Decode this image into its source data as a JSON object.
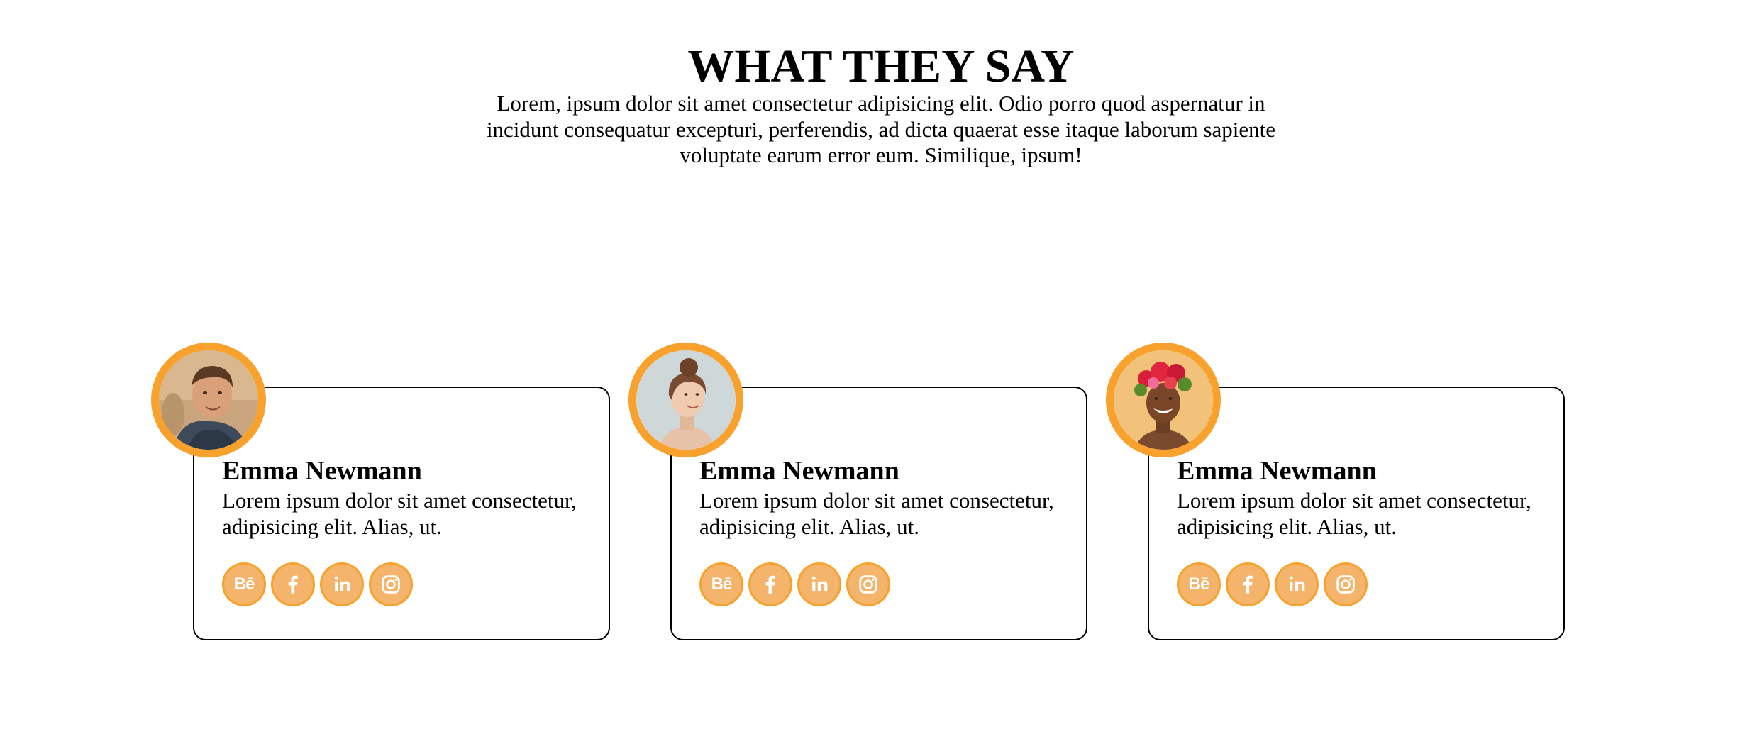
{
  "header": {
    "title": "WHAT THEY SAY",
    "intro": "Lorem, ipsum dolor sit amet consectetur adipisicing elit. Odio porro quod aspernatur in incidunt consequatur excepturi, perferendis, ad dicta quaerat esse itaque laborum sapiente voluptate earum error eum. Similique, ipsum!"
  },
  "colors": {
    "accent": "#f8a12c",
    "social_fill": "#f4b46c",
    "card_border": "#000000"
  },
  "testimonials": [
    {
      "name": "Emma Newmann",
      "text": "Lorem ipsum dolor sit amet consectetur, adipisicing elit. Alias, ut.",
      "avatar": "photo-young-man",
      "socials": [
        {
          "icon": "behance-icon",
          "label": "Bē"
        },
        {
          "icon": "facebook-icon",
          "label": "f"
        },
        {
          "icon": "linkedin-icon",
          "label": "in"
        },
        {
          "icon": "instagram-icon",
          "label": ""
        }
      ]
    },
    {
      "name": "Emma Newmann",
      "text": "Lorem ipsum dolor sit amet consectetur, adipisicing elit. Alias, ut.",
      "avatar": "photo-woman-hair-bun",
      "socials": [
        {
          "icon": "behance-icon",
          "label": "Bē"
        },
        {
          "icon": "facebook-icon",
          "label": "f"
        },
        {
          "icon": "linkedin-icon",
          "label": "in"
        },
        {
          "icon": "instagram-icon",
          "label": ""
        }
      ]
    },
    {
      "name": "Emma Newmann",
      "text": "Lorem ipsum dolor sit amet consectetur, adipisicing elit. Alias, ut.",
      "avatar": "photo-woman-flower-crown",
      "socials": [
        {
          "icon": "behance-icon",
          "label": "Bē"
        },
        {
          "icon": "facebook-icon",
          "label": "f"
        },
        {
          "icon": "linkedin-icon",
          "label": "in"
        },
        {
          "icon": "instagram-icon",
          "label": ""
        }
      ]
    }
  ]
}
